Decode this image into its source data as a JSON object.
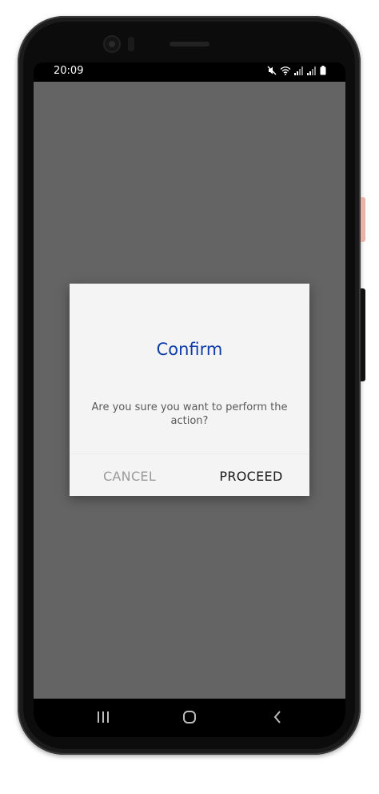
{
  "status_bar": {
    "time": "20:09",
    "icons": [
      "mute-icon",
      "wifi-icon",
      "signal-icon",
      "signal-icon",
      "battery-icon"
    ]
  },
  "dialog": {
    "title": "Confirm",
    "message": "Are you sure you want to perform the action?",
    "cancel_label": "CANCEL",
    "proceed_label": "PROCEED"
  },
  "nav_bar": {
    "icons": [
      "recent-apps-icon",
      "home-icon",
      "back-icon"
    ]
  },
  "colors": {
    "title": "#0d3ca8",
    "overlay": "#646464",
    "dialog_bg": "#f4f4f4",
    "cancel_text": "#9a9a9a",
    "proceed_text": "#1a1a1a"
  }
}
